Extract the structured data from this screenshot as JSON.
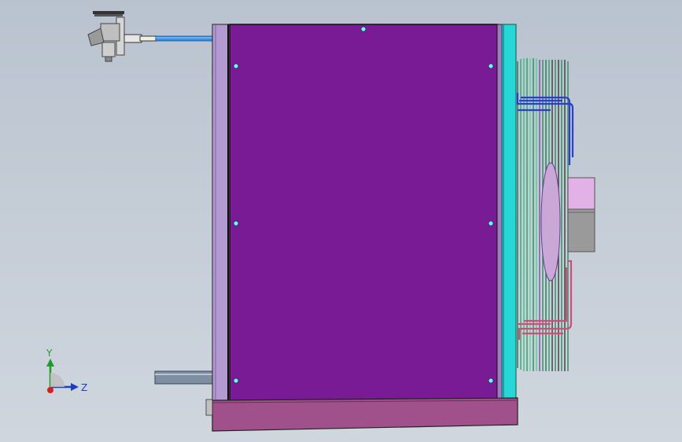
{
  "viewport": {
    "background_top": "#b9c3cf",
    "background_bottom": "#cfd6de"
  },
  "triad": {
    "y_label": "Y",
    "z_label": "Z",
    "y_color": "#1f9b2a",
    "z_color": "#1b3fbd",
    "x_color": "#d21f1f"
  },
  "model": {
    "panel_color": "#7a1b96",
    "frame_color": "#b39ad0",
    "cyan_rail_color": "#27d7d7",
    "base_color": "#a0508a",
    "coil_supply_color": "#2a3fd0",
    "coil_return_color": "#d24d7a",
    "motor_color": "#e2b2e6",
    "pipe_color": "#3b8fe6"
  }
}
